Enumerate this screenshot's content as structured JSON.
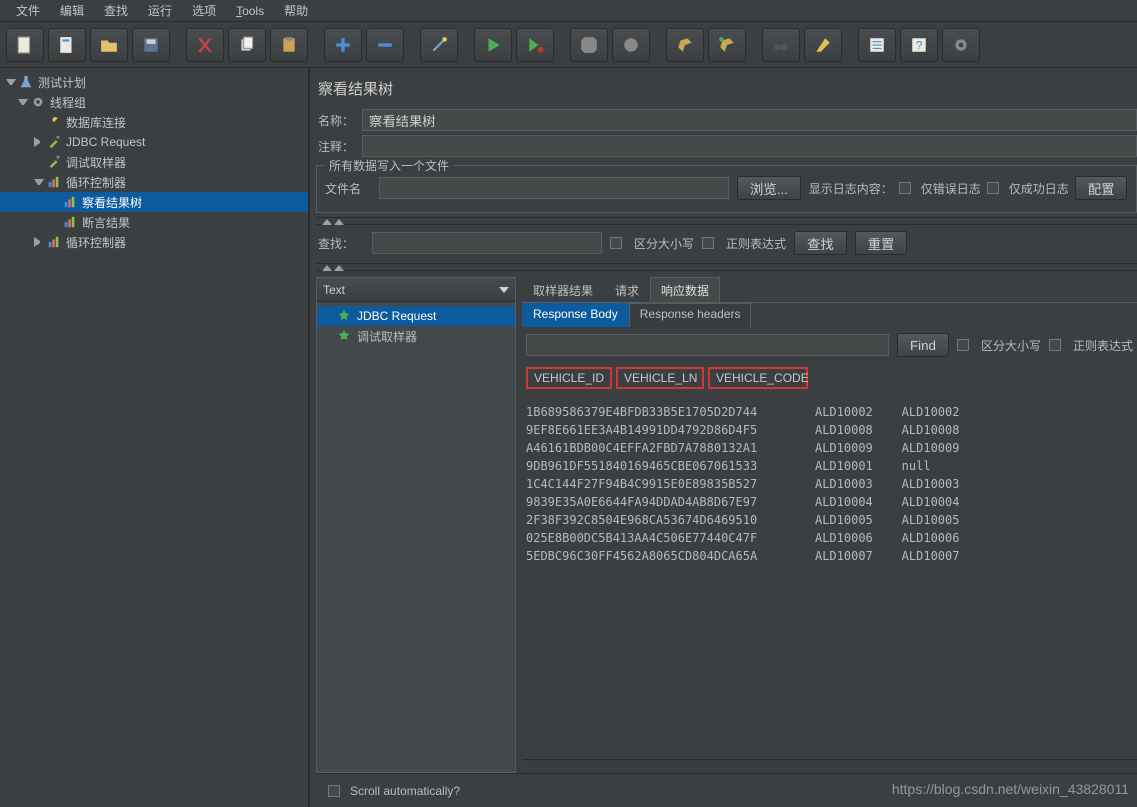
{
  "menu": {
    "items": [
      "文件",
      "编辑",
      "查找",
      "运行",
      "选项",
      "Tools",
      "帮助"
    ]
  },
  "toolbar": {
    "icons": [
      "new",
      "template",
      "open",
      "save",
      "cut",
      "copy",
      "paste",
      "plus",
      "minus",
      "wand",
      "play",
      "play-record",
      "stop",
      "stop2",
      "broom",
      "broom2",
      "binoculars",
      "clear",
      "list",
      "help",
      "gear"
    ]
  },
  "tree": {
    "nodes": [
      {
        "level": 0,
        "twisty": "open",
        "icon": "flask",
        "label": "测试计划"
      },
      {
        "level": 1,
        "twisty": "open",
        "icon": "gear",
        "label": "线程组"
      },
      {
        "level": 2,
        "twisty": "none",
        "icon": "wrench",
        "label": "数据库连接"
      },
      {
        "level": 2,
        "twisty": "closed",
        "icon": "pipette",
        "label": "JDBC Request"
      },
      {
        "level": 2,
        "twisty": "none",
        "icon": "pipette",
        "label": "调试取样器"
      },
      {
        "level": 2,
        "twisty": "open",
        "icon": "chart",
        "label": "循环控制器"
      },
      {
        "level": 3,
        "twisty": "none",
        "icon": "chart",
        "label": "察看结果树",
        "sel": true
      },
      {
        "level": 3,
        "twisty": "none",
        "icon": "chart",
        "label": "断言结果"
      },
      {
        "level": 2,
        "twisty": "closed",
        "icon": "chart",
        "label": "循环控制器"
      }
    ]
  },
  "panel": {
    "title": "察看结果树",
    "name_label": "名称：",
    "name_value": "察看结果树",
    "comment_label": "注释：",
    "comment_value": "",
    "file_fieldset_title": "所有数据写入一个文件",
    "file_label": "文件名",
    "file_value": "",
    "browse_btn": "浏览...",
    "log_label": "显示日志内容：",
    "err_log": "仅错误日志",
    "ok_log": "仅成功日志",
    "config_btn": "配置"
  },
  "search": {
    "label": "查找：",
    "placeholder": "",
    "case_label": "区分大小写",
    "regex_label": "正则表达式",
    "search_btn": "查找",
    "reset_btn": "重置"
  },
  "results": {
    "combo_value": "Text",
    "left_items": [
      {
        "label": "JDBC Request",
        "sel": true
      },
      {
        "label": "调试取样器",
        "sel": false
      }
    ],
    "tabs": [
      "取样器结果",
      "请求",
      "响应数据"
    ],
    "active_tab": 2,
    "subtabs": [
      "Response Body",
      "Response headers"
    ],
    "active_subtab": 0,
    "find_btn": "Find",
    "find_case": "区分大小写",
    "find_regex": "正则表达式",
    "headers": [
      "VEHICLE_ID",
      "VEHICLE_LN",
      "VEHICLE_CODE"
    ],
    "rows": [
      {
        "id": "1B689586379E4BFDB33B5E1705D2D744",
        "ln": "ALD10002",
        "code": "ALD10002"
      },
      {
        "id": "9EF8E661EE3A4B14991DD4792D86D4F5",
        "ln": "ALD10008",
        "code": "ALD10008"
      },
      {
        "id": "A46161BDB00C4EFFA2FBD7A7880132A1",
        "ln": "ALD10009",
        "code": "ALD10009"
      },
      {
        "id": "9DB961DF551840169465CBE067061533",
        "ln": "ALD10001",
        "code": "null"
      },
      {
        "id": "1C4C144F27F94B4C9915E0E89835B527",
        "ln": "ALD10003",
        "code": "ALD10003"
      },
      {
        "id": "9839E35A0E6644FA94DDAD4AB8D67E97",
        "ln": "ALD10004",
        "code": "ALD10004"
      },
      {
        "id": "2F38F392C8504E968CA53674D6469510",
        "ln": "ALD10005",
        "code": "ALD10005"
      },
      {
        "id": "025E8B00DC5B413AA4C506E77440C47F",
        "ln": "ALD10006",
        "code": "ALD10006"
      },
      {
        "id": "5EDBC96C30FF4562A8065CD804DCA65A",
        "ln": "ALD10007",
        "code": "ALD10007"
      }
    ]
  },
  "bottom": {
    "scroll_auto": "Scroll automatically?"
  },
  "watermark": "https://blog.csdn.net/weixin_43828011"
}
